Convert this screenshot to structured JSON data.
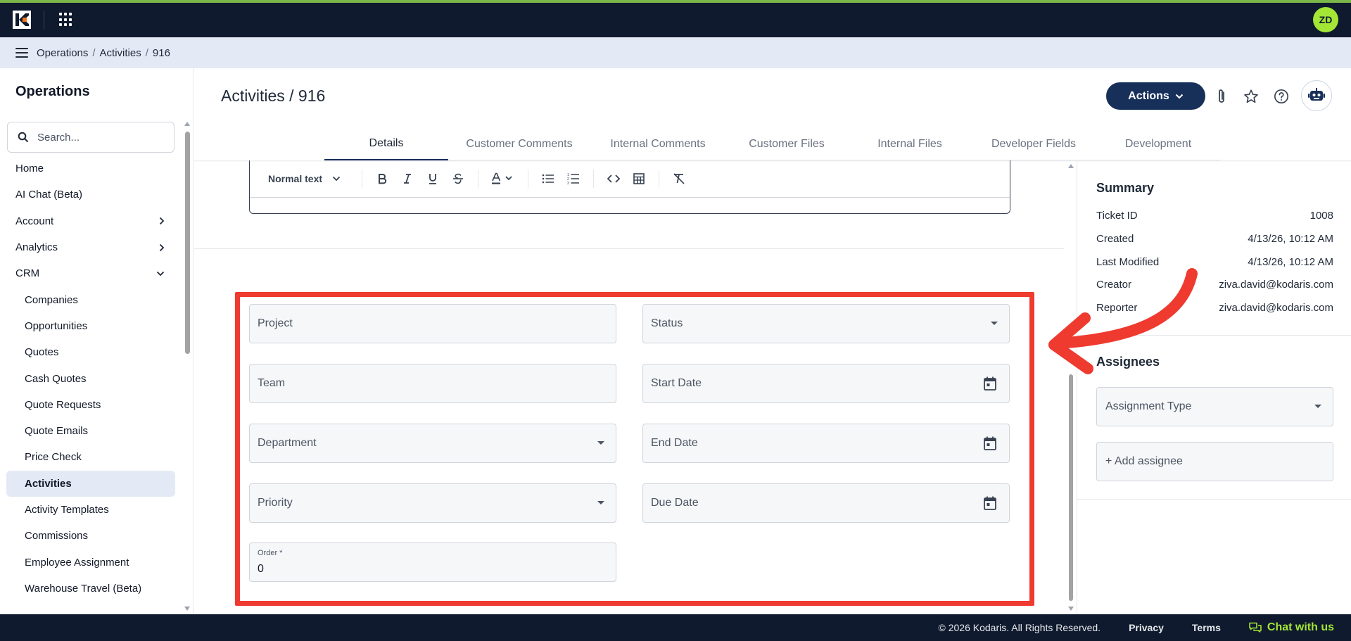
{
  "app": {
    "user_initials": "ZD"
  },
  "breadcrumb": {
    "items": [
      "Operations",
      "Activities",
      "916"
    ],
    "separator": "/"
  },
  "sidebar": {
    "title": "Operations",
    "search_placeholder": "Search...",
    "items": [
      {
        "label": "Home"
      },
      {
        "label": "AI Chat (Beta)"
      },
      {
        "label": "Account"
      },
      {
        "label": "Analytics"
      },
      {
        "label": "CRM"
      },
      {
        "label": "Companies"
      },
      {
        "label": "Opportunities"
      },
      {
        "label": "Quotes"
      },
      {
        "label": "Cash Quotes"
      },
      {
        "label": "Quote Requests"
      },
      {
        "label": "Quote Emails"
      },
      {
        "label": "Price Check"
      },
      {
        "label": "Activities"
      },
      {
        "label": "Activity Templates"
      },
      {
        "label": "Commissions"
      },
      {
        "label": "Employee Assignment"
      },
      {
        "label": "Warehouse Travel (Beta)"
      }
    ]
  },
  "header": {
    "title": "Activities / 916",
    "actions_label": "Actions"
  },
  "tabs": [
    {
      "label": "Details"
    },
    {
      "label": "Customer Comments"
    },
    {
      "label": "Internal Comments"
    },
    {
      "label": "Customer Files"
    },
    {
      "label": "Internal Files"
    },
    {
      "label": "Developer Fields"
    },
    {
      "label": "Development"
    }
  ],
  "editor": {
    "text_style": "Normal text"
  },
  "form": {
    "project": "Project",
    "status": "Status",
    "team": "Team",
    "start_date": "Start Date",
    "department": "Department",
    "end_date": "End Date",
    "priority": "Priority",
    "due_date": "Due Date",
    "order_label": "Order *",
    "order_value": "0"
  },
  "summary": {
    "title": "Summary",
    "rows": [
      {
        "key": "Ticket ID",
        "value": "1008"
      },
      {
        "key": "Created",
        "value": "4/13/26, 10:12 AM"
      },
      {
        "key": "Last Modified",
        "value": "4/13/26, 10:12 AM"
      },
      {
        "key": "Creator",
        "value": "ziva.david@kodaris.com"
      },
      {
        "key": "Reporter",
        "value": "ziva.david@kodaris.com"
      }
    ]
  },
  "assignees": {
    "title": "Assignees",
    "assignment_type": "Assignment Type",
    "add_label": "+ Add assignee"
  },
  "footer": {
    "copyright": "© 2026 Kodaris. All Rights Reserved.",
    "privacy": "Privacy",
    "terms": "Terms",
    "chat": "Chat with us"
  },
  "colors": {
    "topbar": "#0f1a2e",
    "accent_green": "#a3e635",
    "primary_button": "#17305a",
    "highlight_annotation": "#ef3a2f",
    "active_nav_bg": "#e4eaf5"
  }
}
